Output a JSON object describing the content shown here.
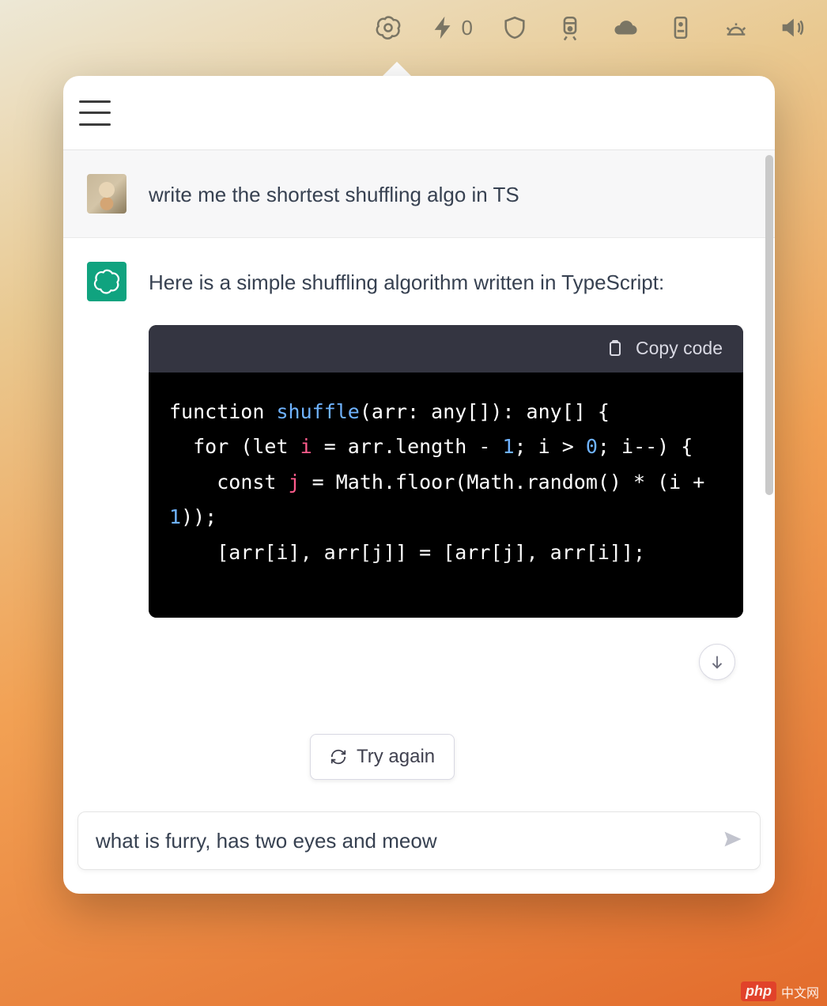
{
  "menubar": {
    "lightning_count": "0"
  },
  "chat": {
    "user_message": "write me the shortest shuffling algo in TS",
    "assistant_intro": "Here is a simple shuffling algorithm written in TypeScript:",
    "copy_label": "Copy code",
    "code": {
      "l1_kw1": "function",
      "l1_fn": "shuffle",
      "l1_rest": "(arr: any[]): any[] {",
      "l2_a": "  for (",
      "l2_kw": "let",
      "l2_sp": " ",
      "l2_var": "i",
      "l2_b": " = arr.length - ",
      "l2_num": "1",
      "l2_c": "; i > ",
      "l3_num": "0",
      "l3_rest": "; i--) {",
      "l4_a": "    const ",
      "l4_var": "j",
      "l4_b": " = ",
      "l5_a": "Math.floor(Math.random() * (i + ",
      "l6_num": "1",
      "l6_rest": "));",
      "l7": "    [arr[i], arr[j]] = [arr[j], arr[i]];"
    },
    "try_again": "Try again"
  },
  "composer": {
    "value": "what is furry, has two eyes and meow"
  },
  "watermark": {
    "brand": "php",
    "text": "中文网"
  }
}
